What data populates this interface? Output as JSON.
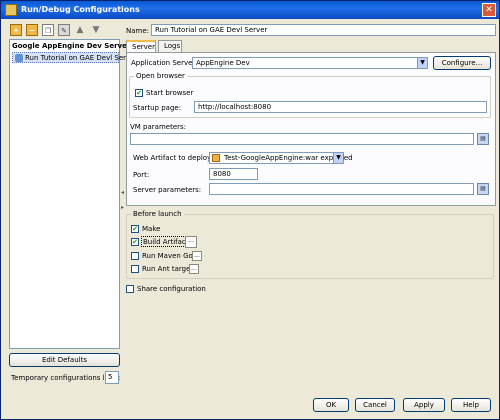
{
  "window": {
    "title": "Run/Debug Configurations"
  },
  "toolbar": {
    "add_icon": "plus-icon",
    "remove_icon": "minus-icon",
    "copy_icon": "copy-icon",
    "edit_icon": "edit-icon",
    "up_icon": "arrow-up-icon",
    "down_icon": "arrow-down-icon"
  },
  "tree": {
    "group": "Google AppEngine Dev Server",
    "items": [
      {
        "label": "Run Tutorial on GAE Devl Server"
      }
    ]
  },
  "left": {
    "edit_defaults": "Edit Defaults",
    "temp_limit_label": "Temporary configurations limit:",
    "temp_limit_value": "5"
  },
  "config": {
    "name_label": "Name:",
    "name_value": "Run Tutorial on GAE Devl Server",
    "tabs": [
      "Server",
      "Logs"
    ],
    "app_server_label": "Application Server:",
    "app_server_value": "AppEngine Dev",
    "configure_label": "Configure...",
    "open_browser_label": "Open browser",
    "start_browser_label": "Start browser",
    "start_browser_checked": true,
    "startup_page_label": "Startup page:",
    "startup_page_value": "http://localhost:8080",
    "vm_params_label": "VM parameters:",
    "vm_params_value": "",
    "web_artifact_label": "Web Artifact to deploy:",
    "web_artifact_value": "Test-GoogleAppEngine:war exploded",
    "port_label": "Port:",
    "port_value": "8080",
    "server_params_label": "Server parameters:",
    "server_params_value": ""
  },
  "before_launch": {
    "label": "Before launch",
    "make_label": "Make",
    "make_checked": true,
    "build_artifacts_label": "Build Artifacts",
    "build_artifacts_checked": true,
    "maven_goal_label": "Run Maven Goal",
    "maven_goal_checked": false,
    "ant_target_label": "Run Ant target",
    "ant_target_checked": false,
    "ellipsis": "..."
  },
  "share": {
    "label": "Share configuration",
    "checked": false
  },
  "buttons": {
    "ok": "OK",
    "cancel": "Cancel",
    "apply": "Apply",
    "help": "Help"
  }
}
